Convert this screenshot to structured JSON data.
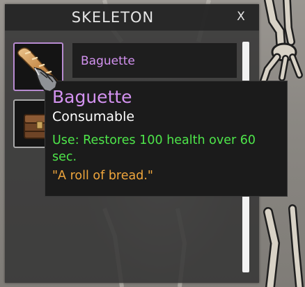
{
  "loot_window": {
    "title": "SKELETON",
    "close_label": "X",
    "slots": [
      {
        "icon": "baguette-icon",
        "state": "selected"
      },
      {
        "icon": "chest-icon",
        "state": "normal"
      }
    ],
    "selected_item_name": "Baguette"
  },
  "tooltip": {
    "name": "Baguette",
    "type": "Consumable",
    "use_text": "Use: Restores 100 health over 60 sec.",
    "flavor_text": "\"A roll of bread.\""
  },
  "colors": {
    "item_name": "#d392f0",
    "use_text": "#4ee64a",
    "flavor_text": "#f0a63c",
    "selected_slot_border": "#b88bd1"
  },
  "cursor": "gauntlet-cursor-icon"
}
